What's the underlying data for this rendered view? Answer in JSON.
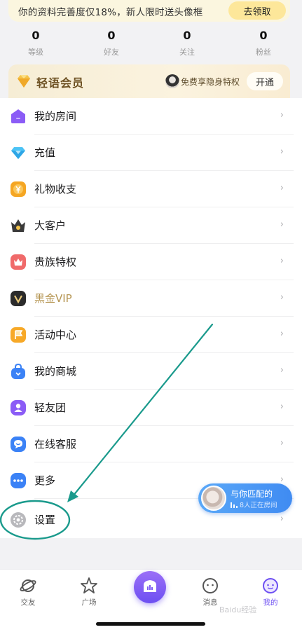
{
  "banner": {
    "text": "你的资料完善度仅18%，新人限时送头像框",
    "button": "去领取"
  },
  "stats": [
    {
      "value": "0",
      "label": "等级"
    },
    {
      "value": "0",
      "label": "好友"
    },
    {
      "value": "0",
      "label": "关注"
    },
    {
      "value": "0",
      "label": "粉丝"
    }
  ],
  "vip": {
    "title": "轻语会员",
    "desc": "免费享隐身特权",
    "button": "开通"
  },
  "menu": [
    {
      "label": "我的房间",
      "icon": "house-icon",
      "color": "#8b5cf6"
    },
    {
      "label": "充值",
      "icon": "diamond-icon",
      "color": "#38bdf8"
    },
    {
      "label": "礼物收支",
      "icon": "yen-coin-icon",
      "color": "#f59e0b"
    },
    {
      "label": "大客户",
      "icon": "crown-icon",
      "color": "#3a3a3a"
    },
    {
      "label": "贵族特权",
      "icon": "noble-icon",
      "color": "#f06a6a"
    },
    {
      "label": "黑金VIP",
      "icon": "vip-v-icon",
      "color": "#2b2b2b"
    },
    {
      "label": "活动中心",
      "icon": "flag-icon",
      "color": "#f59e0b"
    },
    {
      "label": "我的商城",
      "icon": "shopping-bag-icon",
      "color": "#3b82f6"
    },
    {
      "label": "轻友团",
      "icon": "user-badge-icon",
      "color": "#8b5cf6"
    },
    {
      "label": "在线客服",
      "icon": "chat-service-icon",
      "color": "#3b82f6"
    },
    {
      "label": "更多",
      "icon": "more-dots-icon",
      "color": "#3b82f6"
    },
    {
      "label": "设置",
      "icon": "gear-icon",
      "color": "#b8b8bc"
    }
  ],
  "chevron": "›",
  "match": {
    "title": "与你匹配的",
    "subtitle": "8人正在房间"
  },
  "tabs": [
    {
      "label": "交友",
      "icon": "planet-icon"
    },
    {
      "label": "广场",
      "icon": "star-icon"
    },
    {
      "label": "消息",
      "icon": "message-face-icon"
    },
    {
      "label": "我的",
      "icon": "profile-face-icon",
      "active": true
    }
  ],
  "watermark": "Baidu经验",
  "colors": {
    "accent": "#6d4ff2",
    "annotation": "#1a9a8c",
    "banner_bg": "#fbf6df",
    "vip_text": "#6e5224"
  }
}
